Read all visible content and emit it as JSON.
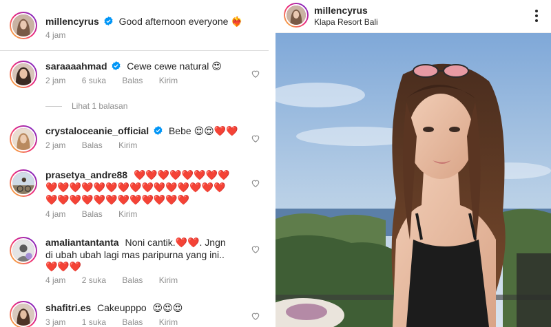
{
  "caption": {
    "username": "millencyrus",
    "text": "Good afternoon everyone",
    "emoji": "❤️‍🔥",
    "time": "4 jam"
  },
  "view_replies": "Lihat 1 balasan",
  "comments": [
    {
      "username": "saraaaahmad",
      "verified": true,
      "text": "Cewe cewe natural",
      "emoji": "😍",
      "time": "2 jam",
      "likes": "6 suka",
      "reply": "Balas",
      "send": "Kirim"
    },
    {
      "username": "crystaloceanie_official",
      "verified": true,
      "text": "Bebe",
      "emoji": "😍😍❤️❤️",
      "time": "2 jam",
      "reply": "Balas",
      "send": "Kirim"
    },
    {
      "username": "prasetya_andre88",
      "verified": false,
      "line1_hearts": "❤️❤️❤️❤️❤️❤️❤️❤️",
      "line2_hearts": "❤️❤️❤️❤️❤️❤️❤️❤️❤️❤️❤️❤️❤️❤️❤️",
      "line3_hearts": "❤️❤️❤️❤️❤️❤️❤️❤️❤️❤️❤️❤️",
      "time": "4 jam",
      "reply": "Balas",
      "send": "Kirim"
    },
    {
      "username": "amaliantantanta",
      "verified": false,
      "text1": "Noni cantik.",
      "emoji1": "❤️❤️",
      "text1b": ". Jngn",
      "text2": "di ubah ubah lagi mas paripurna yang ini..",
      "emoji3": "❤️❤️❤️",
      "time": "4 jam",
      "likes": "2 suka",
      "reply": "Balas",
      "send": "Kirim"
    },
    {
      "username": "shafitri.es",
      "verified": false,
      "text": "Cakeupppo",
      "emoji": "😍😍😍",
      "time": "3 jam",
      "likes": "1 suka",
      "reply": "Balas",
      "send": "Kirim"
    }
  ],
  "post": {
    "username": "millencyrus",
    "location": "Klapa Resort Bali"
  },
  "icons": {
    "verified": "verified-badge-icon",
    "like": "heart-outline-icon",
    "more": "more-options-icon"
  },
  "colors": {
    "verified_blue": "#0095f6",
    "heart_red": "#ed4956",
    "meta_gray": "#8e8e8e"
  }
}
